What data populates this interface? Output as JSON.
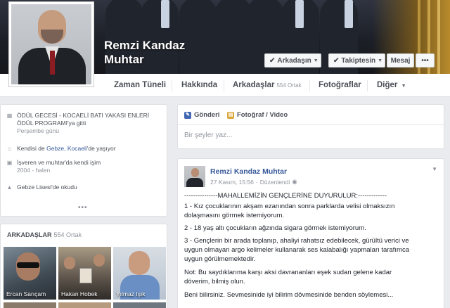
{
  "profile": {
    "name_line1": "Remzi Kandaz",
    "name_line2": "Muhtar"
  },
  "cover_buttons": {
    "friend": "Arkadaşın",
    "follow": "Takiptesin",
    "message": "Mesaj",
    "more": "•••"
  },
  "tabs": {
    "timeline": "Zaman Tüneli",
    "about": "Hakkında",
    "friends": "Arkadaşlar",
    "friends_count": "554 Ortak",
    "photos": "Fotoğraflar",
    "more": "Diğer"
  },
  "about": {
    "event_line1": "ÖDÜL GECESİ - KOCAELİ BATI YAKASI ENLERİ",
    "event_line2": "ÖDÜL PROGRAMI'ya gitti",
    "event_date": "Perşembe günü",
    "lives_prefix": "Kendisi de",
    "lives_place": "Gebze, Kocaeli",
    "lives_suffix": "'de yaşıyor",
    "work_line1": "İşveren ve muhtar'da kendi işim",
    "work_line2": "2004 - halen",
    "school": "Gebze Lisesi'de okudu",
    "more": "•••"
  },
  "friends_box": {
    "title": "ARKADAŞLAR",
    "count": "554 Ortak",
    "items": [
      {
        "name": "Ercan Sarıçam"
      },
      {
        "name": "Hakan Hobek"
      },
      {
        "name": "Yılmaz Işık"
      }
    ]
  },
  "composer": {
    "status": "Gönderi",
    "photo": "Fotoğraf / Video",
    "placeholder": "Bir şeyler yaz..."
  },
  "post": {
    "author": "Remzi Kandaz Muhtar",
    "date": "27 Kasım, 15:56",
    "edited": "Düzenlendi",
    "lines": [
      "---------------MAHALLEMİZİN GENÇLERİNE DUYURULUR:-------------",
      "1 - Kız çocuklarının akşam ezanından sonra parklarda velisi olmaksızın",
      "dolaşmasını görmek istemiyorum.",
      "2 - 18 yaş altı çocukların ağzında sigara görmek istemiyorum.",
      "3 - Gençlerin bir arada toplanıp, ahaliyi rahatsız edebilecek, gürültü verici ve",
      "uygun olmayan argo kelimeler kullanarak ses kalabalığı yapmaları tarafımca",
      "uygun görülmemektedir.",
      "Not: Bu saydıklarıma karşı aksi davrananları eşek sudan gelene kadar",
      "döverim, bilmiş olun.",
      "Beni bilirsiniz. Sevmesinide iyi bilirim dövmesinide benden söylemesi..."
    ]
  },
  "colors": {
    "link": "#365899",
    "muted": "#90949c",
    "background": "#e9ebee"
  }
}
